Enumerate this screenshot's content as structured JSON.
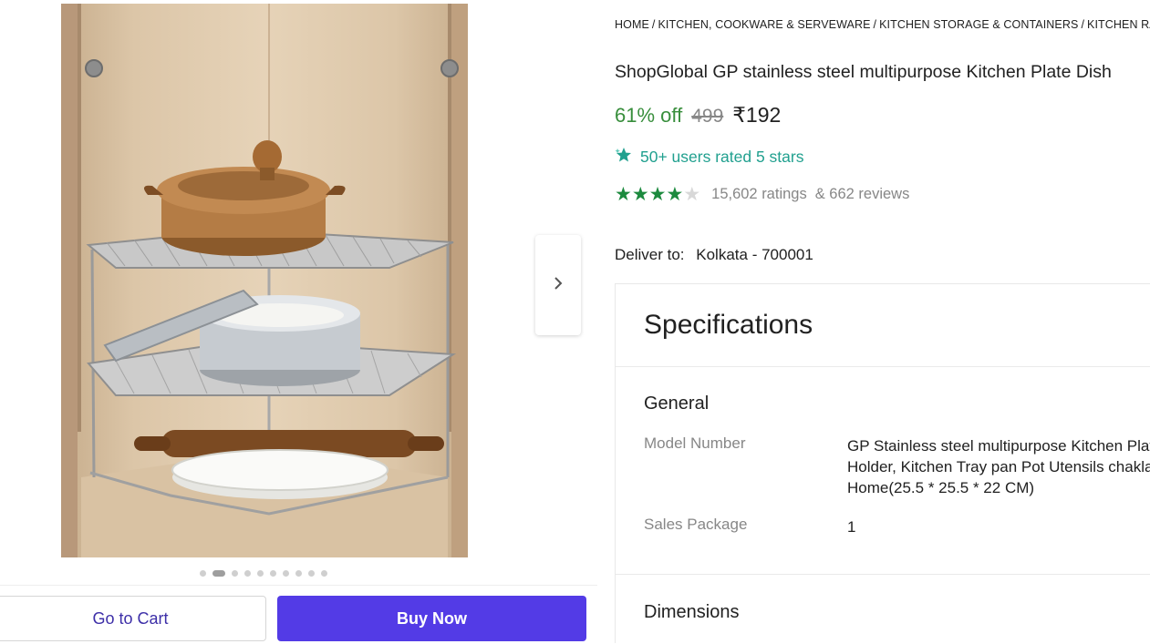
{
  "breadcrumb": {
    "items": [
      "HOME",
      "KITCHEN, COOKWARE & SERVEWARE",
      "KITCHEN STORAGE & CONTAINERS",
      "KITCHEN RAC"
    ],
    "separator": "/"
  },
  "product": {
    "title": "ShopGlobal GP stainless steel multipurpose Kitchen Plate Dish",
    "discount": "61% off",
    "mrp": "499",
    "price": "₹192",
    "rated_badge": "50+ users rated 5 stars",
    "rating_stars": 4,
    "rating_max": 5,
    "ratings_count": "15,602 ratings",
    "reviews_count": "& 662 reviews"
  },
  "delivery": {
    "label": "Deliver to:",
    "location": "Kolkata - 700001"
  },
  "gallery": {
    "total_images": 10,
    "active_index": 1,
    "next_icon": "chevron-right-icon"
  },
  "actions": {
    "cart_label": "Go to Cart",
    "buy_label": "Buy Now"
  },
  "specifications": {
    "title": "Specifications",
    "general_title": "General",
    "model_number_key": "Model Number",
    "model_number_value_line1": "GP Stainless steel multipurpose Kitchen Plat",
    "model_number_value_line2": "Holder, Kitchen Tray pan Pot Utensils chakla",
    "model_number_value_line3": "Home(25.5 * 25.5 * 22 CM)",
    "sales_package_key": "Sales Package",
    "sales_package_value": "1",
    "dimensions_title": "Dimensions"
  },
  "colors": {
    "discount_green": "#388e3c",
    "star_green": "#1c8a3e",
    "rated_teal": "#21a08f",
    "buy_button": "#533be6",
    "cart_text": "#3d2fa8"
  }
}
